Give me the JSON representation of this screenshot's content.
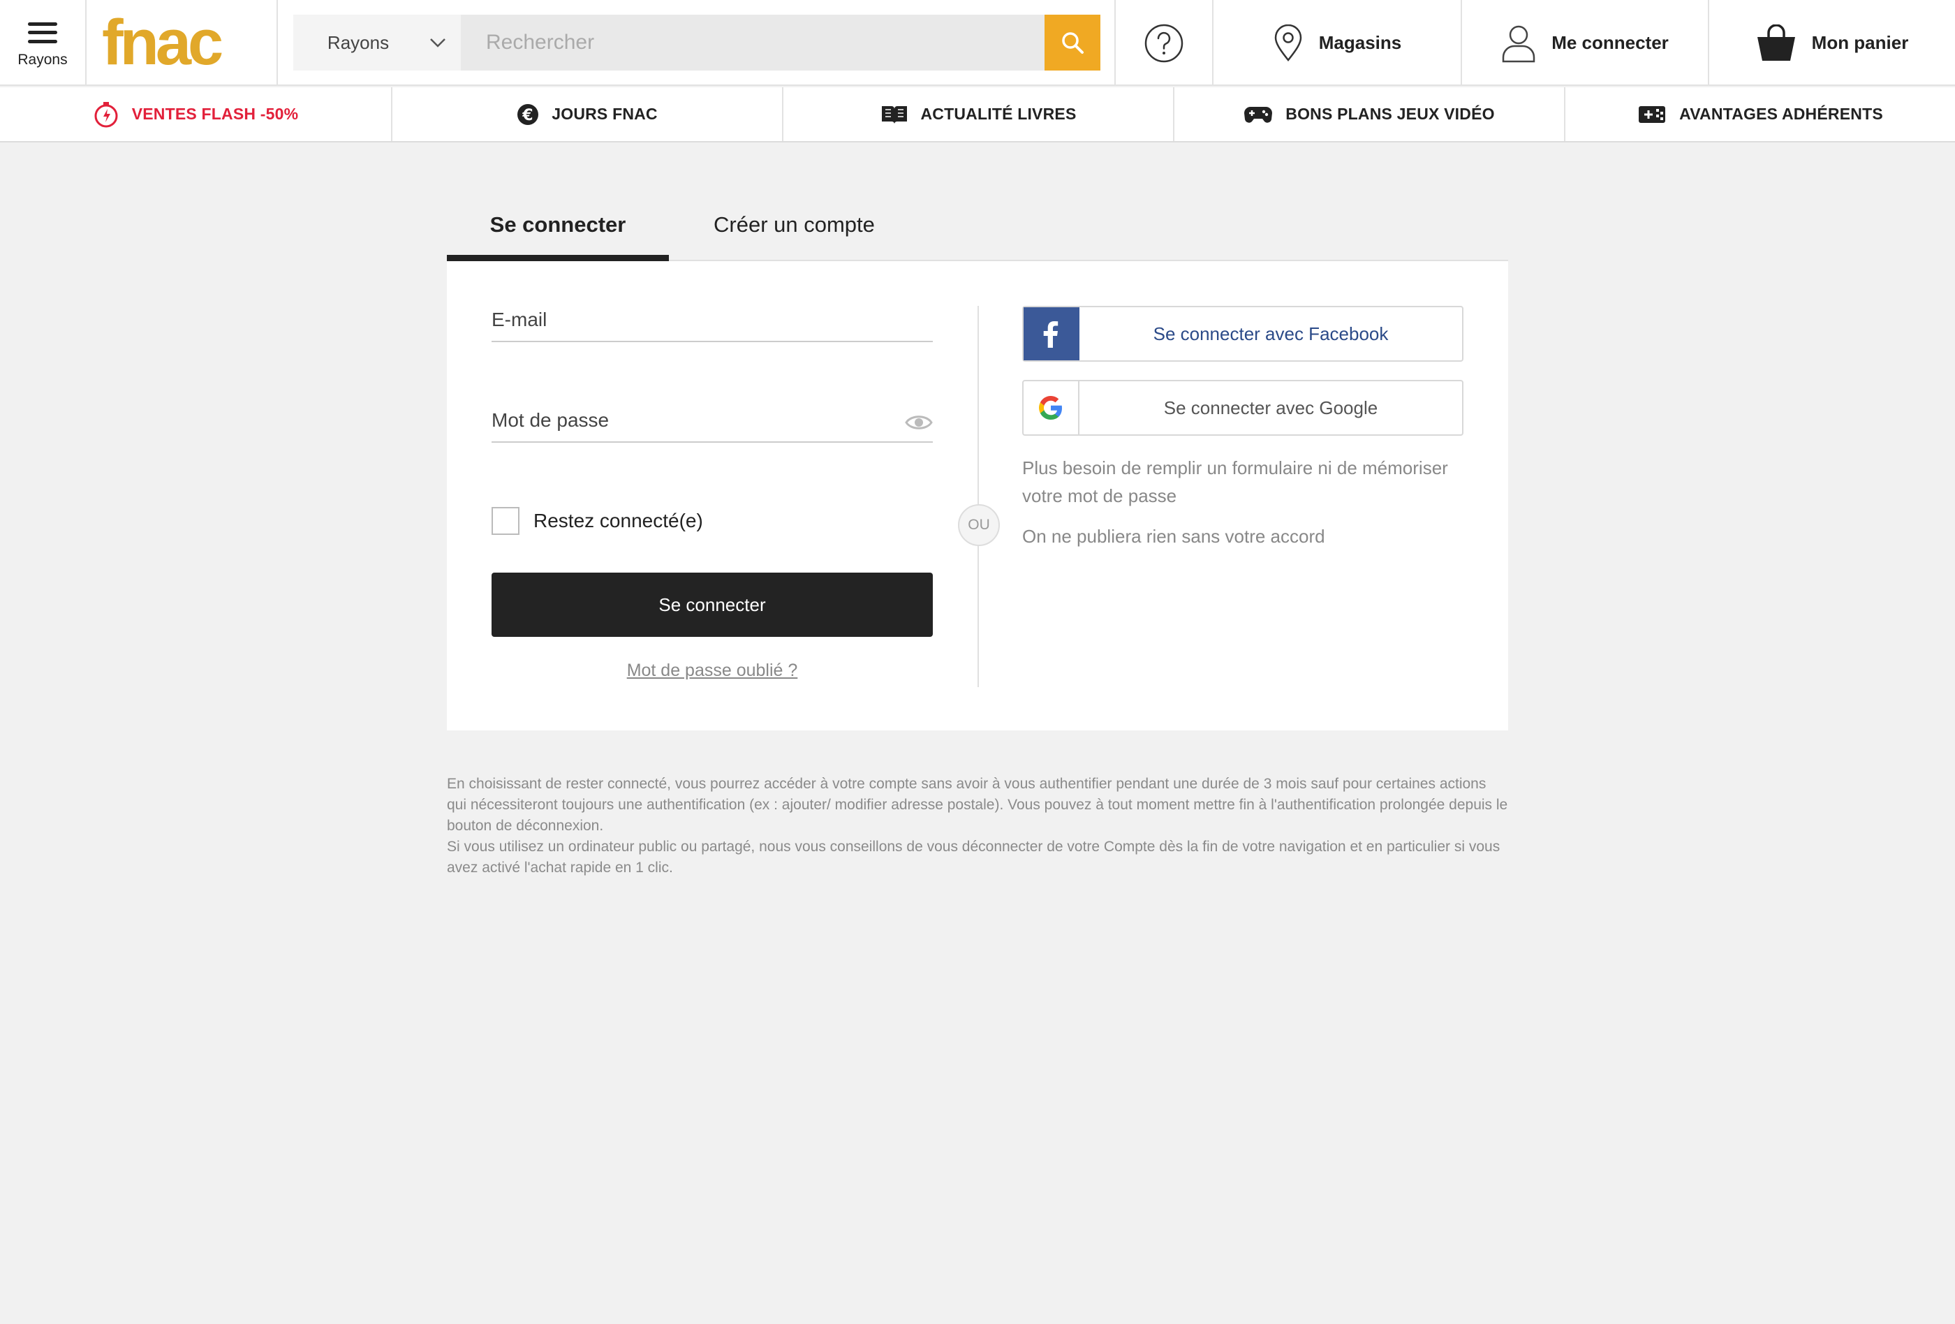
{
  "header": {
    "menu_label": "Rayons",
    "logo_text": "fnac",
    "search": {
      "category_label": "Rayons",
      "placeholder": "Rechercher"
    },
    "help_icon": "question-circle-icon",
    "nav": {
      "stores_label": "Magasins",
      "login_label": "Me connecter",
      "cart_label": "Mon panier"
    },
    "colors": {
      "brand_yellow": "#f0a923",
      "flash_red": "#e2203a"
    }
  },
  "categories": [
    {
      "label": "VENTES FLASH -50%",
      "icon": "stopwatch-icon"
    },
    {
      "label": "JOURS FNAC",
      "icon": "euro-icon"
    },
    {
      "label": "ACTUALITÉ LIVRES",
      "icon": "book-icon"
    },
    {
      "label": "BONS PLANS JEUX VIDÉO",
      "icon": "gamepad-icon"
    },
    {
      "label": "AVANTAGES ADHÉRENTS",
      "icon": "member-card-icon"
    }
  ],
  "login": {
    "tab_login": "Se connecter",
    "tab_register": "Créer un compte",
    "email_placeholder": "E-mail",
    "password_placeholder": "Mot de passe",
    "remember_label": "Restez connecté(e)",
    "submit_label": "Se connecter",
    "forgot_label": "Mot de passe oublié ?",
    "or_label": "OU",
    "facebook_label": "Se connecter avec Facebook",
    "google_label": "Se connecter avec Google",
    "note_1": "Plus besoin de remplir un formulaire ni de mémoriser votre mot de passe",
    "note_2": "On ne publiera rien sans votre accord"
  },
  "legal": {
    "paragraph_1": "En choisissant de rester connecté, vous pourrez accéder à votre compte sans avoir à vous authentifier pendant une durée de 3 mois sauf pour certaines actions qui nécessiteront toujours une authentification (ex : ajouter/ modifier adresse postale). Vous pouvez à tout moment mettre fin à l'authentification prolongée depuis le bouton de déconnexion.",
    "paragraph_2": "Si vous utilisez un ordinateur public ou partagé, nous vous conseillons de vous déconnecter de votre Compte dès la fin de votre navigation et en particulier si vous avez activé l'achat rapide en 1 clic."
  }
}
